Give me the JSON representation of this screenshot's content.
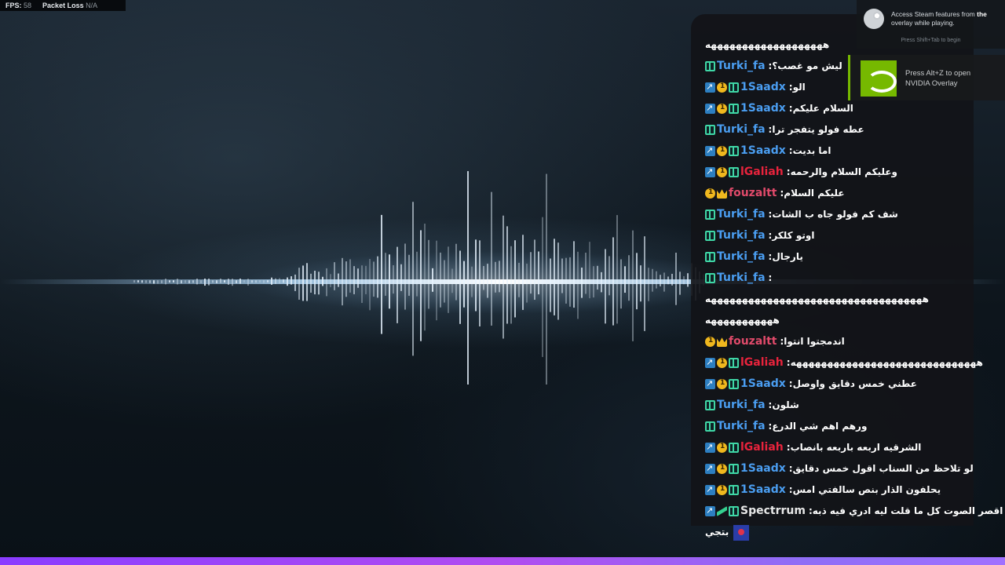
{
  "stats": {
    "fps_label": "FPS:",
    "fps_value": "58",
    "packet_loss_label": "Packet Loss",
    "packet_loss_value": "N/A"
  },
  "steam_notice": {
    "text_prefix": "Access Steam features from ",
    "text_bold": "the",
    "text_suffix": " overlay while playing.",
    "hint": "Press Shift+Tab to begin"
  },
  "nvidia_notice": {
    "line1": "Press Alt+Z to open",
    "line2": "NVIDIA Overlay"
  },
  "chat": {
    "lines": [
      {
        "type": "plain",
        "text": "هههههههههههههههههههه"
      },
      {
        "badges": [
          "green"
        ],
        "user": "Turki_fa",
        "color": "#4a9df0",
        "msg": "ليش مو غصب؟"
      },
      {
        "badges": [
          "blue",
          "gold",
          "green"
        ],
        "user": "1Saadx",
        "color": "#4a9df0",
        "msg": "الو"
      },
      {
        "badges": [
          "blue",
          "gold",
          "green"
        ],
        "user": "1Saadx",
        "color": "#4a9df0",
        "msg": "السلام عليكم"
      },
      {
        "badges": [
          "green"
        ],
        "user": "Turki_fa",
        "color": "#4a9df0",
        "msg": "عطه فولو يتفجر ترا"
      },
      {
        "badges": [
          "blue",
          "gold",
          "green"
        ],
        "user": "1Saadx",
        "color": "#4a9df0",
        "msg": "اما بديت"
      },
      {
        "badges": [
          "blue",
          "gold",
          "green"
        ],
        "user": "lGaliah",
        "color": "#e8233c",
        "msg": "وعليكم السلام والرحمه"
      },
      {
        "badges": [
          "gold",
          "crown"
        ],
        "user": "fouzaltt",
        "color": "#e04a6a",
        "msg": "عليكم السلام"
      },
      {
        "badges": [
          "green"
        ],
        "user": "Turki_fa",
        "color": "#4a9df0",
        "msg": "شف كم فولو جاه ب الشات"
      },
      {
        "badges": [
          "green"
        ],
        "user": "Turki_fa",
        "color": "#4a9df0",
        "msg": "اوتو كلكر"
      },
      {
        "badges": [
          "green"
        ],
        "user": "Turki_fa",
        "color": "#4a9df0",
        "msg": "يارجال"
      },
      {
        "badges": [
          "green"
        ],
        "user": "Turki_fa",
        "color": "#4a9df0",
        "msg": ""
      },
      {
        "type": "plain",
        "text": "هههههههههههههههههههههههههههههههههههه"
      },
      {
        "type": "plain",
        "text": "هههههههههههه"
      },
      {
        "badges": [
          "gold",
          "crown"
        ],
        "user": "fouzaltt",
        "color": "#e04a6a",
        "msg": "اندمجتوا انتوا"
      },
      {
        "badges": [
          "blue",
          "gold",
          "green"
        ],
        "user": "lGaliah",
        "color": "#e8233c",
        "msg": "ههههههههههههههههههههههههههههههه"
      },
      {
        "badges": [
          "blue",
          "gold",
          "green"
        ],
        "user": "1Saadx",
        "color": "#4a9df0",
        "msg": "عطني خمس دقايق واوصل"
      },
      {
        "badges": [
          "green"
        ],
        "user": "Turki_fa",
        "color": "#4a9df0",
        "msg": "شلون"
      },
      {
        "badges": [
          "green"
        ],
        "user": "Turki_fa",
        "color": "#4a9df0",
        "msg": "ورهم اهم شي الدرع"
      },
      {
        "badges": [
          "blue",
          "gold",
          "green"
        ],
        "user": "lGaliah",
        "color": "#e8233c",
        "msg": "الشرقيه اربعه باربعه بانصاب"
      },
      {
        "badges": [
          "blue",
          "gold",
          "green"
        ],
        "user": "1Saadx",
        "color": "#4a9df0",
        "msg": "لو تلاحظ من السناب اقول خمس دقايق"
      },
      {
        "badges": [
          "blue",
          "gold",
          "green"
        ],
        "user": "1Saadx",
        "color": "#4a9df0",
        "msg": "يحلفون الذار بنص سالفتي امس"
      },
      {
        "badges": [
          "blue",
          "slash",
          "green"
        ],
        "user": "Spectrrum",
        "color": "#e8e8e8",
        "msg": "اقصر الصوت كل ما قلت ليه ادري فيه ذبه"
      },
      {
        "type": "plain",
        "text": "بتجي",
        "emote": true
      }
    ]
  }
}
